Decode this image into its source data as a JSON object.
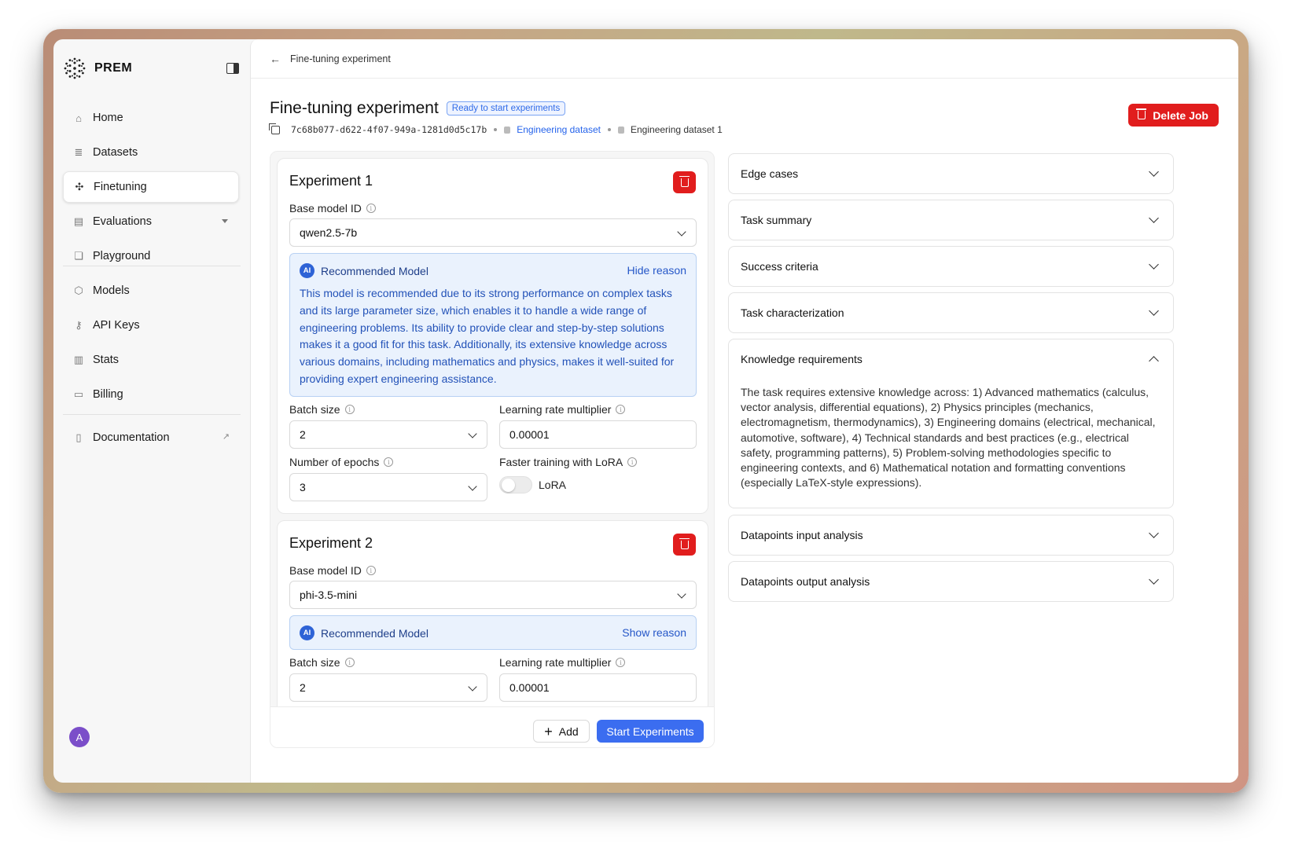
{
  "app": {
    "brand": "PREM"
  },
  "sidebar": {
    "items": [
      {
        "label": "Home",
        "icon": "home-icon"
      },
      {
        "label": "Datasets",
        "icon": "database-icon"
      },
      {
        "label": "Finetuning",
        "icon": "finetuning-icon",
        "active": true
      },
      {
        "label": "Evaluations",
        "icon": "evaluations-icon",
        "has_dropdown": true
      },
      {
        "label": "Playground",
        "icon": "chat-icon"
      },
      {
        "label": "Models",
        "icon": "cube-icon"
      },
      {
        "label": "API Keys",
        "icon": "key-icon"
      },
      {
        "label": "Stats",
        "icon": "chart-icon"
      },
      {
        "label": "Billing",
        "icon": "card-icon"
      },
      {
        "label": "Documentation",
        "icon": "document-icon",
        "external": true
      }
    ],
    "avatar_initial": "A"
  },
  "breadcrumb": {
    "label": "Fine-tuning experiment"
  },
  "header": {
    "title": "Fine-tuning experiment",
    "status": "Ready to start experiments",
    "job_id": "7c68b077-d622-4f07-949a-1281d0d5c17b",
    "dataset": "Engineering dataset",
    "snapshot": "Engineering dataset 1",
    "delete_label": "Delete Job"
  },
  "experiments": [
    {
      "title": "Experiment 1",
      "base_model_label": "Base model ID",
      "base_model": "qwen2.5-7b",
      "recommended_label": "Recommended Model",
      "reason_toggle": "Hide reason",
      "reason": "This model is recommended due to its strong performance on complex tasks and its large parameter size, which enables it to handle a wide range of engineering problems. Its ability to provide clear and step-by-step solutions makes it a good fit for this task. Additionally, its extensive knowledge across various domains, including mathematics and physics, makes it well-suited for providing expert engineering assistance.",
      "batch_size_label": "Batch size",
      "batch_size": "2",
      "lr_label": "Learning rate multiplier",
      "lr": "0.00001",
      "epochs_label": "Number of epochs",
      "epochs": "3",
      "lora_label": "Faster training with LoRA",
      "lora_toggle_label": "LoRA",
      "lora_enabled": false
    },
    {
      "title": "Experiment 2",
      "base_model_label": "Base model ID",
      "base_model": "phi-3.5-mini",
      "recommended_label": "Recommended Model",
      "reason_toggle": "Show reason",
      "batch_size_label": "Batch size",
      "batch_size": "2",
      "lr_label": "Learning rate multiplier",
      "lr": "0.00001"
    }
  ],
  "actions": {
    "add_label": "Add",
    "start_label": "Start Experiments"
  },
  "accordions": [
    {
      "title": "Edge cases",
      "expanded": false
    },
    {
      "title": "Task summary",
      "expanded": false
    },
    {
      "title": "Success criteria",
      "expanded": false
    },
    {
      "title": "Task characterization",
      "expanded": false
    },
    {
      "title": "Knowledge requirements",
      "expanded": true,
      "body": "The task requires extensive knowledge across: 1) Advanced mathematics (calculus, vector analysis, differential equations), 2) Physics principles (mechanics, electromagnetism, thermodynamics), 3) Engineering domains (electrical, mechanical, automotive, software), 4) Technical standards and best practices (e.g., electrical safety, programming patterns), 5) Problem-solving methodologies specific to engineering contexts, and 6) Mathematical notation and formatting conventions (especially LaTeX-style expressions)."
    },
    {
      "title": "Datapoints input analysis",
      "expanded": false
    },
    {
      "title": "Datapoints output analysis",
      "expanded": false
    }
  ],
  "colors": {
    "primary": "#3b6df0",
    "danger": "#e11d1d",
    "link": "#2563eb",
    "recommend_bg": "#eaf2fd"
  }
}
